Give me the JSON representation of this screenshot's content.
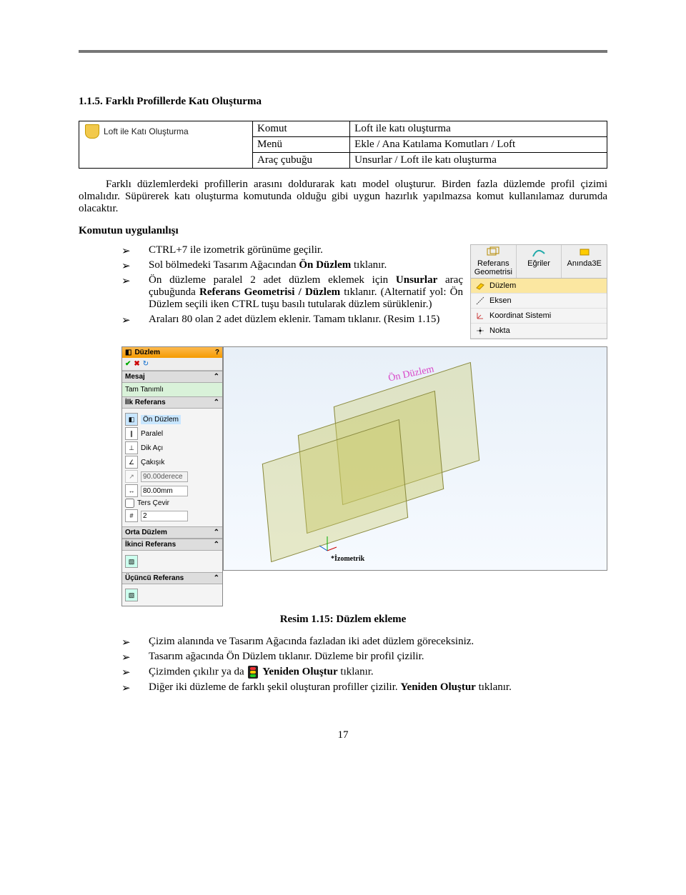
{
  "section_number": "1.1.5. Farklı Profillerde Katı Oluşturma",
  "table": {
    "icon_label": "Loft ile Katı Oluşturma",
    "rows": [
      {
        "k": "Komut",
        "v": "Loft ile katı oluşturma"
      },
      {
        "k": "Menü",
        "v": "Ekle / Ana Katılama Komutları / Loft"
      },
      {
        "k": "Araç çubuğu",
        "v": "Unsurlar / Loft ile katı oluşturma"
      }
    ]
  },
  "para1": "Farklı düzlemlerdeki profillerin arasını doldurarak katı model oluşturur. Birden fazla düzlemde profil çizimi olmalıdır. Süpürerek katı oluşturma komutunda olduğu gibi uygun hazırlık yapılmazsa komut kullanılamaz durumda olacaktır.",
  "subhead": "Komutun uygulanılışı",
  "steps1": [
    "CTRL+7 ile izometrik görünüme geçilir.",
    {
      "pre": "Sol bölmedeki Tasarım Ağacından ",
      "b": "Ön Düzlem",
      "post": " tıklanır."
    },
    {
      "pre": "Ön düzleme paralel 2 adet düzlem eklemek için ",
      "b": "Unsurlar",
      "post_pre": " araç çubuğunda ",
      "b2": "Referans Geometrisi / Düzlem",
      "post": " tıklanır. (Alternatif yol: Ön Düzlem seçili iken CTRL tuşu basılı tutularak düzlem sürüklenir.)"
    },
    "Araları 80 olan 2 adet düzlem eklenir. Tamam tıklanır. (Resim 1.15)"
  ],
  "ref_panel": {
    "top": [
      {
        "icon_color": "#e6b800",
        "label": "Referans Geometrisi"
      },
      {
        "icon_color": "#2aa",
        "label": "Eğriler"
      },
      {
        "icon_color": "#d4a000",
        "label": "Anında3E"
      }
    ],
    "items": [
      {
        "label": "Düzlem",
        "hl": true
      },
      {
        "label": "Eksen"
      },
      {
        "label": "Koordinat Sistemi"
      },
      {
        "label": "Nokta"
      }
    ]
  },
  "cad_panel": {
    "title": "Düzlem",
    "sections": [
      {
        "name": "Mesaj",
        "body_type": "msg",
        "msg": "Tam Tanımlı"
      },
      {
        "name": "İlk Referans",
        "body_type": "ref1",
        "rows": [
          {
            "ic": "◧",
            "label": "Ön Düzlem"
          },
          {
            "ic": "∥",
            "label": "Paralel"
          },
          {
            "ic": "⊥",
            "label": "Dik Açı"
          },
          {
            "ic": "∠",
            "label": "Çakışık"
          },
          {
            "ic": "↗",
            "input": "90.00derece",
            "dim": true
          },
          {
            "ic": "↔",
            "input": "80.00mm"
          },
          {
            "checkbox": true,
            "label": "Ters Çevir"
          },
          {
            "ic": "#",
            "input": "2"
          }
        ]
      },
      {
        "name": "Orta Düzlem",
        "body_type": "empty"
      },
      {
        "name": "İkinci Referans",
        "body_type": "cube"
      },
      {
        "name": "Üçüncü Referans",
        "body_type": "cube"
      }
    ],
    "iso": "*İzometrik"
  },
  "plane_label": "Ön Düzlem",
  "caption": "Resim 1.15: Düzlem ekleme",
  "steps2": [
    "Çizim alanında ve Tasarım Ağacında fazladan iki adet düzlem göreceksiniz.",
    "Tasarım ağacında Ön Düzlem tıklanır. Düzleme bir profil çizilir.",
    {
      "pre": "Çizimden çıkılır ya da ",
      "icon": true,
      "b": "Yeniden Oluştur",
      "post": " tıklanır."
    },
    {
      "pre": "Diğer iki düzleme de farklı şekil oluşturan profiller çizilir. ",
      "b": "Yeniden Oluştur",
      "post": " tıklanır."
    }
  ],
  "page_number": "17"
}
